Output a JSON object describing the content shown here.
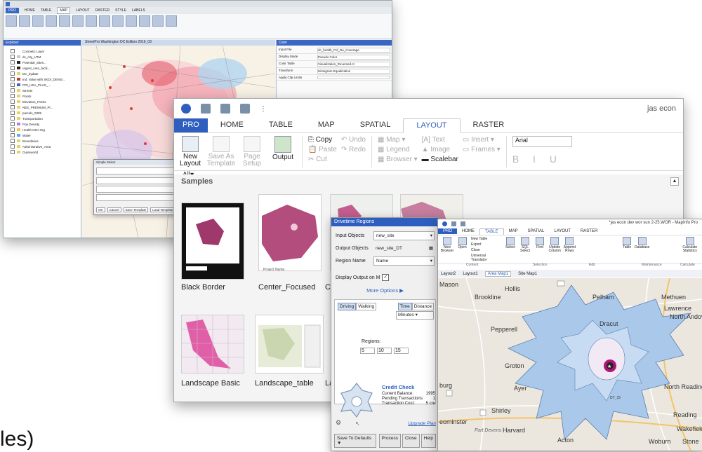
{
  "w1": {
    "tabs": [
      "PRO",
      "HOME",
      "TABLE",
      "MAP",
      "LAYOUT",
      "RASTER",
      "STYLE",
      "LABELS"
    ],
    "explorer_title": "Explorer",
    "layers": [
      {
        "label": "Cosmetic Layer",
        "color": "#ffffff"
      },
      {
        "label": "dc_city_UTM",
        "color": "#c8c8c8"
      },
      {
        "label": "Potential_Sites...",
        "color": "#222222"
      },
      {
        "label": "urgent_care_facili...",
        "color": "#222222"
      },
      {
        "label": "DC_bydate",
        "color": "#e8d36a"
      },
      {
        "label": "Ind. Value with SKDI_DENSI...",
        "color": "#c0392b"
      },
      {
        "label": "POI_USA_PLUS_...",
        "color": "#3a66c4"
      },
      {
        "label": "Streets",
        "color": "#e8d36a"
      },
      {
        "label": "Points",
        "color": "#e8d36a"
      },
      {
        "label": "Elevation_Points",
        "color": "#e8d36a"
      },
      {
        "label": "NEE_PREMIUM_Pl...",
        "color": "#e8d36a"
      },
      {
        "label": "parcels_0309",
        "color": "#e8d36a"
      },
      {
        "label": "Transportation",
        "color": "#e8d36a"
      },
      {
        "label": "Pop Density",
        "color": "#b07fd0"
      },
      {
        "label": "Health Inter Org",
        "color": "#f2c94c"
      },
      {
        "label": "Water",
        "color": "#5da9e9"
      },
      {
        "label": "Boundaries",
        "color": "#e8d36a"
      },
      {
        "label": "Administrative_Area",
        "color": "#e8d36a"
      },
      {
        "label": "Outerworld",
        "color": "#e8d36a"
      }
    ],
    "map_title": "StreetPro Washington DC Edition 2016_03",
    "prop_title": "Color",
    "prop_rows": [
      {
        "k": "Input File",
        "v": "dc_health_Pol_No_Coverage"
      },
      {
        "k": "Display Mode",
        "v": "Pseudo Color"
      },
      {
        "k": "Color Table",
        "v": "Visualization_Reversed.ct"
      },
      {
        "k": "Transform",
        "v": "Histogram Equalization"
      },
      {
        "k": "Apply Clip Limits",
        "v": ""
      }
    ],
    "dialog_title": "Simple Select",
    "dialog_buttons": [
      "OK",
      "Cancel",
      "Save Template",
      "Load Template"
    ]
  },
  "w2": {
    "title": "jas econ",
    "tabs": [
      "PRO",
      "HOME",
      "TABLE",
      "MAP",
      "SPATIAL",
      "LAYOUT",
      "RASTER"
    ],
    "active_tab": "LAYOUT",
    "ribbon": {
      "new_layout": "New Layout",
      "save_as_template": "Save As Template",
      "page_setup": "Page Setup",
      "output": "Output",
      "copy": "Copy",
      "undo": "Undo",
      "paste": "Paste",
      "redo": "Redo",
      "cut": "Cut",
      "map": "Map",
      "legend": "Legend",
      "browser": "Browser",
      "text": "Text",
      "image": "Image",
      "scalebar": "Scalebar",
      "insert": "Insert",
      "frames": "Frames",
      "font": "Arial",
      "biu": "B I U"
    },
    "filter": "All",
    "samples_title": "Samples",
    "thumbs": [
      {
        "label": "Black Border"
      },
      {
        "label": "Center_Focused"
      },
      {
        "label": "Cl"
      },
      {
        "label": ""
      },
      {
        "label": "Landscape Basic"
      },
      {
        "label": "Landscape_table"
      },
      {
        "label": "La"
      }
    ]
  },
  "dlg": {
    "title": "Drivetime Regions",
    "input_objects_label": "Input Objects",
    "input_objects": "new_site",
    "output_objects_label": "Output Objects",
    "output_objects": "new_site_DT",
    "region_name_label": "Region Name",
    "region_name": "Name",
    "display_output_label": "Display Output on M",
    "more_options": "More Options ▶",
    "driving": "Driving",
    "walking": "Walking",
    "time": "Time",
    "distance": "Distance",
    "units": "Minutes",
    "regions_label": "Regions:",
    "regions": [
      "5",
      "10",
      "15"
    ],
    "credit_title": "Credit Check",
    "current_balance_label": "Current Balance:",
    "current_balance": "1995",
    "pending_label": "Pending Transactions:",
    "pending": "1",
    "cost_label": "Transaction Cost:",
    "cost": "5 cre",
    "upgrade": "Upgrade Plan",
    "save_defaults": "Save To Defaults ▼",
    "process": "Process",
    "close": "Close",
    "help": "Help"
  },
  "w3": {
    "title": "*jas econ dev wor sun 2-25.WOR - MapInfo Pro",
    "tabs": [
      "PRO",
      "HOME",
      "TABLE",
      "MAP",
      "SPATIAL",
      "LAYOUT",
      "RASTER"
    ],
    "active_tab": "TABLE",
    "ribbon": [
      "New Browser",
      "Open",
      "Close",
      "Universal Translator",
      "Select",
      "SQL Select",
      "Find",
      "Update Column",
      "Append Rows",
      "Table",
      "Database",
      "Calculate Statistics"
    ],
    "ribbon_small": [
      "New Table",
      "Export"
    ],
    "groups": [
      "Content",
      "Selection",
      "Edit",
      "Maintenance",
      "Calculate"
    ],
    "doc_tabs": [
      "Layout2",
      "Layout1",
      "Area Map1",
      "Site Map1"
    ],
    "places": [
      "Mason",
      "Hollis",
      "Brookline",
      "Pelham",
      "Methuen",
      "Lawrence",
      "North Andover",
      "Dracut",
      "Pepperell",
      "Groton",
      "burg",
      "Ayer",
      "Shirley",
      "Harvard",
      "North Reading",
      "Reading",
      "Wakefield",
      "Acton",
      "Woburn",
      "Stone",
      "eominster",
      "Fort Devens",
      "DT_15"
    ],
    "colors": {
      "outer": "#a9c8ea",
      "mid": "#c7dcf2",
      "inner": "#f1e9f3",
      "site": "#b0137a"
    }
  },
  "background_text": "les)"
}
